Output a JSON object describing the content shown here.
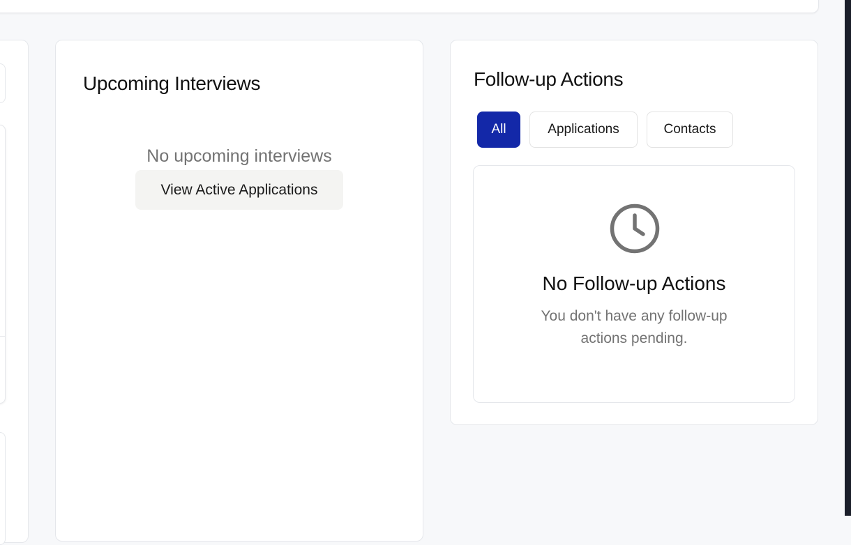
{
  "interviews": {
    "title": "Upcoming Interviews",
    "empty_text": "No upcoming interviews",
    "button_label": "View Active Applications"
  },
  "followup": {
    "title": "Follow-up Actions",
    "tabs": [
      {
        "label": "All",
        "active": true
      },
      {
        "label": "Applications",
        "active": false
      },
      {
        "label": "Contacts",
        "active": false
      }
    ],
    "empty_state": {
      "icon": "clock-icon",
      "title": "No Follow-up Actions",
      "description": "You don't have any follow-up actions pending."
    }
  },
  "colors": {
    "accent": "#1328a8",
    "background": "#f7f8fa",
    "muted_text": "#737373",
    "icon": "#737373"
  }
}
